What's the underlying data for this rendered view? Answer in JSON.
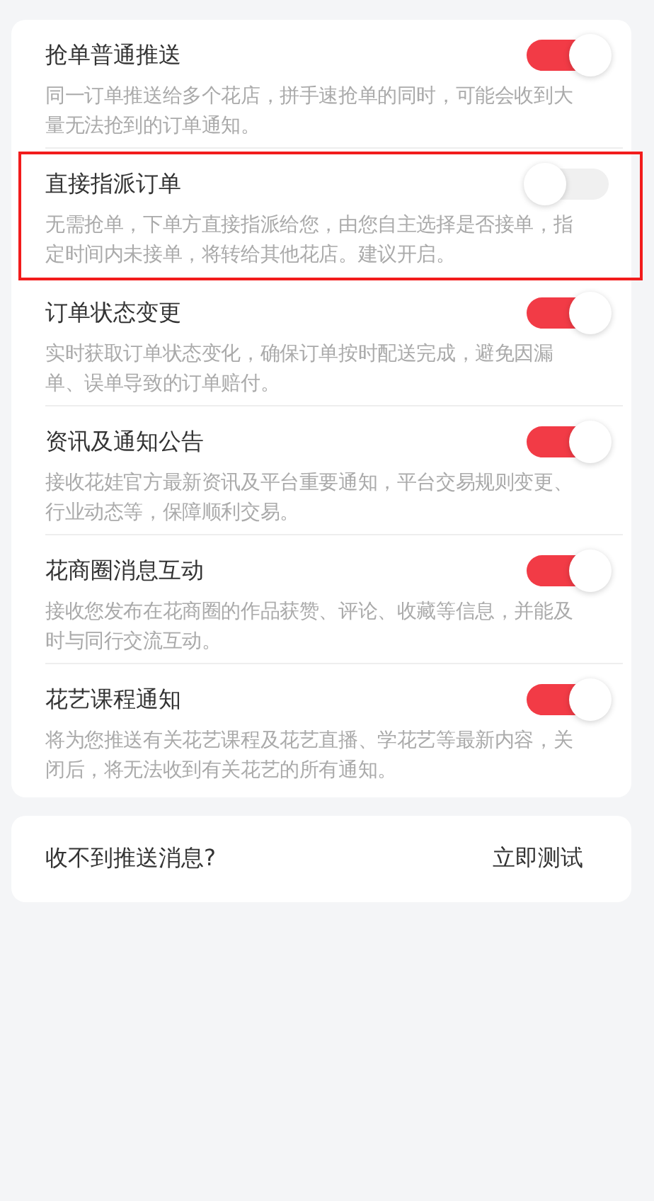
{
  "settings": [
    {
      "title": "抢单普通推送",
      "description": "同一订单推送给多个花店，拼手速抢单的同时，可能会收到大量无法抢到的订单通知。",
      "on": true,
      "highlighted": false
    },
    {
      "title": "直接指派订单",
      "description": "无需抢单，下单方直接指派给您，由您自主选择是否接单，指定时间内未接单，将转给其他花店。建议开启。",
      "on": false,
      "highlighted": true
    },
    {
      "title": "订单状态变更",
      "description": "实时获取订单状态变化，确保订单按时配送完成，避免因漏单、误单导致的订单赔付。",
      "on": true,
      "highlighted": false
    },
    {
      "title": "资讯及通知公告",
      "description": "接收花娃官方最新资讯及平台重要通知，平台交易规则变更、行业动态等，保障顺利交易。",
      "on": true,
      "highlighted": false
    },
    {
      "title": "花商圈消息互动",
      "description": "接收您发布在花商圈的作品获赞、评论、收藏等信息，并能及时与同行交流互动。",
      "on": true,
      "highlighted": false
    },
    {
      "title": "花艺课程通知",
      "description": "将为您推送有关花艺课程及花艺直播、学花艺等最新内容，关闭后，将无法收到有关花艺的所有通知。",
      "on": true,
      "highlighted": false
    }
  ],
  "test_card": {
    "question": "收不到推送消息?",
    "action": "立即测试"
  }
}
